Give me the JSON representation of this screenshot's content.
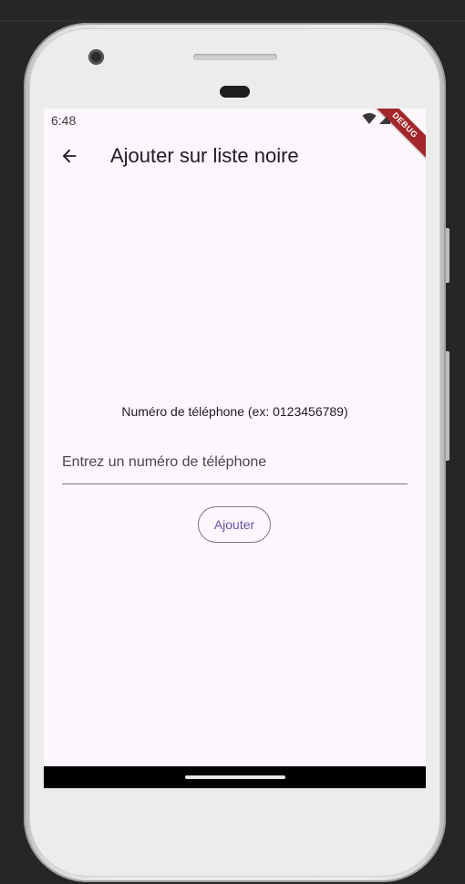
{
  "status_bar": {
    "time": "6:48",
    "icons": [
      "wifi-icon",
      "signal-icon",
      "battery-icon"
    ],
    "debug_label": "DEBUG"
  },
  "app_bar": {
    "back_icon": "arrow-left-icon",
    "title": "Ajouter sur liste noire"
  },
  "form": {
    "label": "Numéro de téléphone (ex: 0123456789)",
    "input_value": "",
    "input_placeholder": "Entrez un numéro de téléphone",
    "submit_label": "Ajouter"
  },
  "colors": {
    "background": "#fdf7fd",
    "accent": "#6750a4",
    "debug_banner": "#a3262a",
    "nav_bar": "#000000"
  }
}
